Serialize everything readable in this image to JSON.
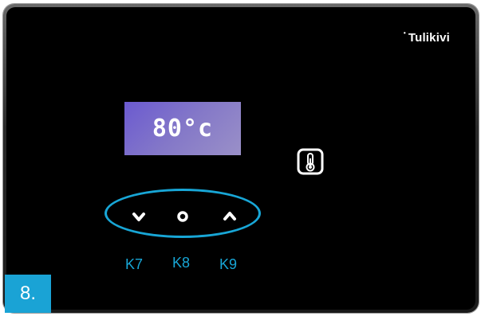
{
  "brand": {
    "name": "Tulikivi",
    "mark": "•"
  },
  "display": {
    "temperature": "80°c"
  },
  "icons": {
    "thermometer": "thermometer-icon",
    "down": "chevron-down-icon",
    "ok": "circle-icon",
    "up": "chevron-up-icon"
  },
  "keys": [
    {
      "label": "K7",
      "function": "down"
    },
    {
      "label": "K8",
      "function": "select"
    },
    {
      "label": "K9",
      "function": "up"
    }
  ],
  "step": {
    "number": "8."
  },
  "colors": {
    "accent": "#18a6d6",
    "display": "#7a6cd0",
    "panel": "#000000"
  }
}
